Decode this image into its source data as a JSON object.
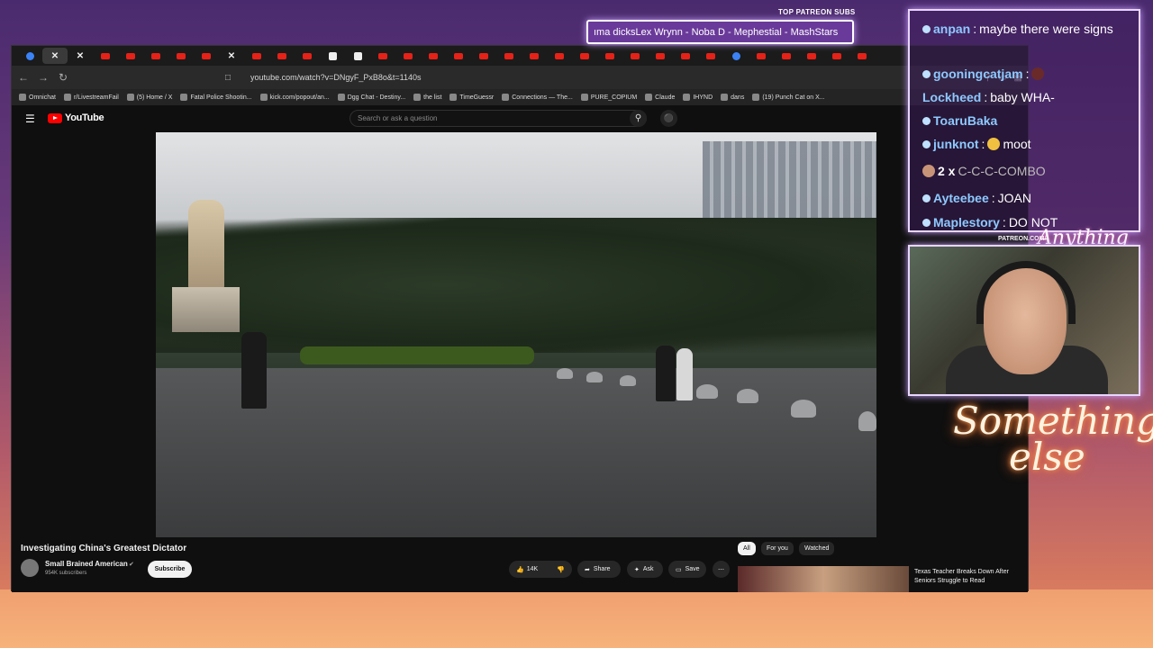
{
  "colors": {
    "accent": "#ff0000",
    "chat_user": "#8ec9ff",
    "neon": "#fff3e0"
  },
  "browser": {
    "url": "youtube.com/watch?v=DNgyF_PxB8o&t=1140s",
    "tabs": [
      "blue",
      "active-x",
      "x",
      "yt",
      "yt",
      "yt",
      "yt",
      "yt",
      "x",
      "yt",
      "yt",
      "yt",
      "w",
      "w",
      "yt",
      "yt",
      "yt",
      "yt",
      "yt",
      "yt",
      "yt",
      "yt",
      "yt",
      "yt",
      "yt",
      "yt",
      "yt",
      "yt",
      "blue",
      "yt",
      "yt",
      "yt",
      "yt",
      "yt"
    ],
    "bookmarks": [
      "Omnichat",
      "r/LivestreamFail",
      "(5) Home / X",
      "Fatal Police Shootin...",
      "kick.com/popout/an...",
      "Dgg Chat - Destiny...",
      "the list",
      "TimeGuessr",
      "Connections — The...",
      "PURE_COPIUM",
      "Claude",
      "IHYND",
      "dans",
      "(19) Punch Cat on X..."
    ]
  },
  "youtube": {
    "logo": "YouTube",
    "search_placeholder": "Search or ask a question",
    "video_title": "Investigating China's Greatest Dictator",
    "channel": "Small Brained American",
    "subscribers": "954K subscribers",
    "subscribe": "Subscribe",
    "likes": "14K",
    "share": "Share",
    "ask": "Ask",
    "save": "Save",
    "chips": [
      "All",
      "For you",
      "Watched"
    ],
    "rec_title": "Texas Teacher Breaks Down After Seniors Struggle to Read"
  },
  "overlay": {
    "patreon_label": "TOP PATREON SUBS",
    "patreon_scroll": "ıma dicksLex Wrynn -  Noba D - Mephestial - MashStars",
    "patreon_url": "PATREON.COM/",
    "patreon_sig": "Anything else",
    "neon_line1": "Something",
    "neon_line2": "else"
  },
  "chat": [
    {
      "user": "anpan",
      "text": "maybe there were signs"
    },
    {
      "user": "gooningcatjam",
      "text": ""
    },
    {
      "user": "Lockheed",
      "text": "baby WHA-"
    },
    {
      "user": "ToaruBaka",
      "text": ""
    },
    {
      "user": "junknot",
      "text": "moot"
    },
    {
      "user": "2 x",
      "text": "C-C-C-COMBO"
    },
    {
      "user": "Ayteebee",
      "text": "JOAN"
    },
    {
      "user": "Maplestory",
      "text": "DO NOT"
    }
  ]
}
